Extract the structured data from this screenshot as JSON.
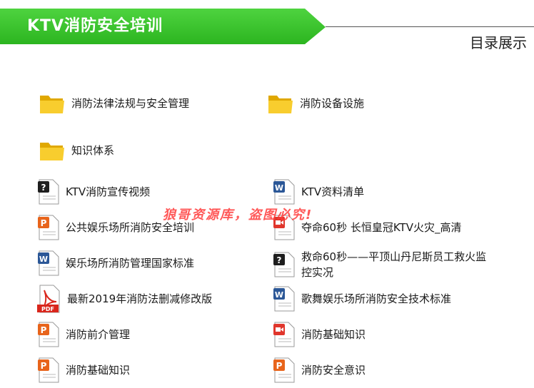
{
  "header": {
    "title": "KTV消防安全培训",
    "toc_label": "目录展示"
  },
  "folders": [
    {
      "label": "消防法律法规与安全管理",
      "icon": "folder-icon"
    },
    {
      "label": "消防设备设施",
      "icon": "folder-icon"
    },
    {
      "label": "知识体系",
      "icon": "folder-icon"
    }
  ],
  "files_left": [
    {
      "label": "KTV消防宣传视频",
      "icon": "unknown-file-icon"
    },
    {
      "label": "公共娱乐场所消防安全培训",
      "icon": "ppt-file-icon"
    },
    {
      "label": "娱乐场所消防管理国家标准",
      "icon": "word-file-icon"
    },
    {
      "label": "最新2019年消防法删减修改版",
      "icon": "pdf-file-icon",
      "badge": "PDF"
    },
    {
      "label": "消防前介管理",
      "icon": "ppt-file-icon"
    },
    {
      "label": "消防基础知识",
      "icon": "ppt-file-icon"
    }
  ],
  "files_right": [
    {
      "label": "KTV资料清单",
      "icon": "word-file-icon"
    },
    {
      "label": "夺命60秒 长恒皇冠KTV火灾_高清",
      "icon": "video-file-icon"
    },
    {
      "label": "救命60秒——平顶山丹尼斯员工救火监控实况",
      "icon": "unknown-file-icon"
    },
    {
      "label": "歌舞娱乐场所消防安全技术标准",
      "icon": "word-file-icon"
    },
    {
      "label": "消防基础知识",
      "icon": "video-file-icon"
    },
    {
      "label": "消防安全意识",
      "icon": "ppt-file-icon"
    }
  ],
  "watermark": "狼哥资源库，盗图必究!",
  "colors": {
    "banner_green": "#2cb520",
    "folder_yellow": "#f5c518",
    "ppt_orange": "#e8641b",
    "word_blue": "#2b5797",
    "pdf_red": "#d9261c",
    "video_red": "#e0362c",
    "watermark_red": "#ff3b3b"
  }
}
